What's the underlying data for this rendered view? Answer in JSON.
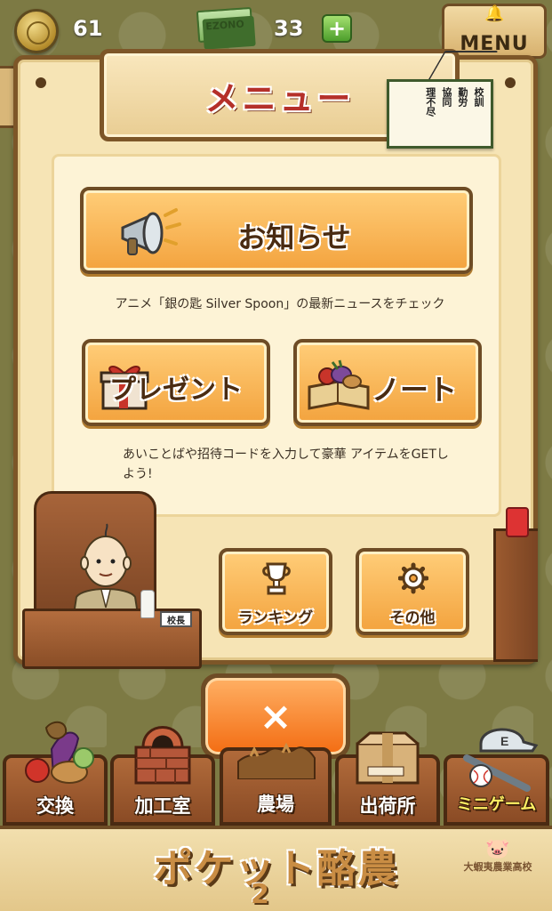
{
  "status": {
    "coins": "61",
    "ezono_label": "EZONO",
    "tickets": "33",
    "plus_label": "+",
    "menu_label": "MENU"
  },
  "panel": {
    "title": "メニュー",
    "motto_heading": "校訓",
    "motto_lines": [
      "勤労",
      "協同",
      "理不尽"
    ],
    "news_button": "お知らせ",
    "news_caption": "アニメ「銀の匙 Silver Spoon」の最新ニュースをチェック",
    "present_button": "プレゼント",
    "note_button": "ノート",
    "present_caption": "あいことばや招待コードを入力して豪華 アイテムをGETしよう!",
    "ranking_button": "ランキング",
    "other_button": "その他",
    "nameplate": "校長"
  },
  "close_label": "×",
  "nav": [
    {
      "label": "交換",
      "icon": "vegetables-icon"
    },
    {
      "label": "加工室",
      "icon": "brick-oven-icon"
    },
    {
      "label": "農場",
      "icon": "farm-icon"
    },
    {
      "label": "出荷所",
      "icon": "shipping-box-icon"
    },
    {
      "label": "ミニゲーム",
      "icon": "baseball-icon"
    }
  ],
  "footer": {
    "logo": "ポケット酪農",
    "number": "2",
    "school_text": "大蝦夷農業高校"
  },
  "colors": {
    "button_orange": "#f3a33e",
    "close_orange": "#f36c12",
    "title_red": "#b5302a",
    "frame_brown": "#7d5628",
    "minigame_yellow": "#fff064"
  }
}
